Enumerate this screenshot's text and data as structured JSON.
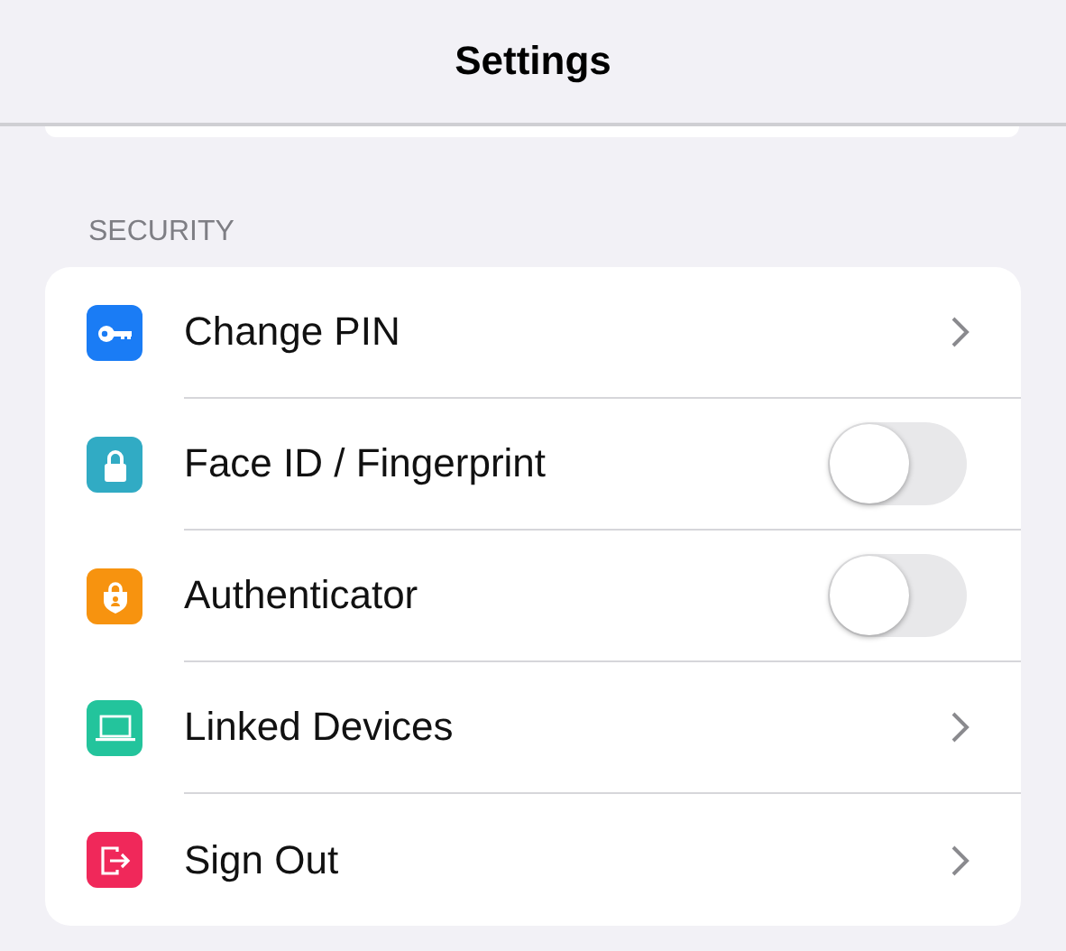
{
  "header": {
    "title": "Settings"
  },
  "section": {
    "title": "SECURITY"
  },
  "rows": [
    {
      "label": "Change PIN",
      "kind": "link",
      "color": "#1a7cf5"
    },
    {
      "label": "Face ID / Fingerprint",
      "kind": "toggle",
      "on": false,
      "color": "#31abc4"
    },
    {
      "label": "Authenticator",
      "kind": "toggle",
      "on": false,
      "color": "#f7930f"
    },
    {
      "label": "Linked Devices",
      "kind": "link",
      "color": "#23c49c"
    },
    {
      "label": "Sign Out",
      "kind": "link",
      "color": "#f0285a"
    }
  ]
}
